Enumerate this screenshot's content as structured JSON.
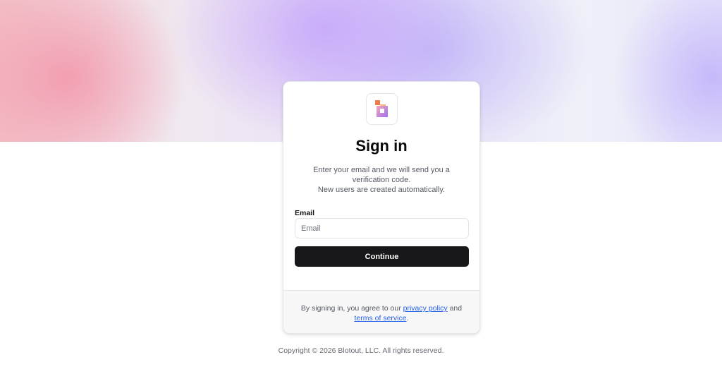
{
  "page": {
    "copyright": "Copyright © 2026 Blotout, LLC. All rights reserved."
  },
  "card": {
    "logo_icon": "blotout-logo-icon",
    "title": "Sign in",
    "subtitle_line1": "Enter your email and we will send you a verification code.",
    "subtitle_line2": "New users are created automatically.",
    "email_label": "Email",
    "email_value": "",
    "email_placeholder": "Email",
    "continue_label": "Continue",
    "legal": {
      "prefix": "By signing in, you agree to our",
      "privacy_link": "privacy policy",
      "joiner": "and",
      "terms_link": "terms of service",
      "suffix": "."
    }
  },
  "colors": {
    "button_bg": "#18181b",
    "link": "#2563eb",
    "logo_orange": "#f07b4a",
    "logo_pink": "#f3a6b8",
    "logo_purple": "#a070f0"
  }
}
